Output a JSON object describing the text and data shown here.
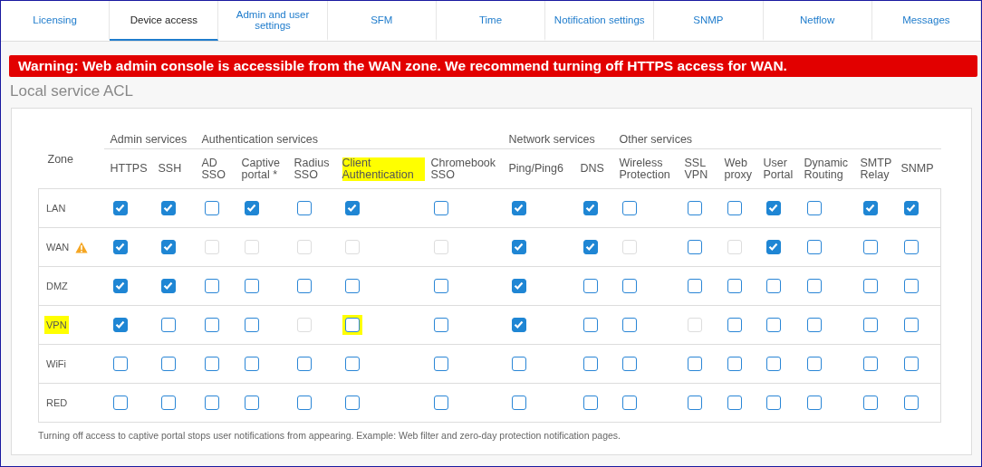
{
  "tabs": [
    {
      "label": "Licensing",
      "selected": false
    },
    {
      "label": "Device access",
      "selected": true
    },
    {
      "label": "Admin and user settings",
      "selected": false
    },
    {
      "label": "SFM",
      "selected": false
    },
    {
      "label": "Time",
      "selected": false
    },
    {
      "label": "Notification settings",
      "selected": false
    },
    {
      "label": "SNMP",
      "selected": false
    },
    {
      "label": "Netflow",
      "selected": false
    },
    {
      "label": "Messages",
      "selected": false
    }
  ],
  "warning_banner": "Warning: Web admin console is accessible from the WAN zone. We recommend turning off HTTPS access for WAN.",
  "section_title": "Local service ACL",
  "table": {
    "zone_heading": "Zone",
    "groups": [
      {
        "label": "Admin services",
        "columns": [
          {
            "label": "HTTPS",
            "highlighted": false
          },
          {
            "label": "SSH",
            "highlighted": false
          }
        ]
      },
      {
        "label": "Authentication services",
        "columns": [
          {
            "label": "AD SSO",
            "highlighted": false
          },
          {
            "label": "Captive portal *",
            "highlighted": false
          },
          {
            "label": "Radius SSO",
            "highlighted": false
          },
          {
            "label": "Client Authentication",
            "highlighted": true
          },
          {
            "label": "Chromebook SSO",
            "highlighted": false
          }
        ]
      },
      {
        "label": "Network services",
        "columns": [
          {
            "label": "Ping/Ping6",
            "highlighted": false
          },
          {
            "label": "DNS",
            "highlighted": false
          }
        ]
      },
      {
        "label": "Other services",
        "columns": [
          {
            "label": "Wireless Protection",
            "highlighted": false
          },
          {
            "label": "SSL VPN",
            "highlighted": false
          },
          {
            "label": "Web proxy",
            "highlighted": false
          },
          {
            "label": "User Portal",
            "highlighted": false
          },
          {
            "label": "Dynamic Routing",
            "highlighted": false
          },
          {
            "label": "SMTP Relay",
            "highlighted": false
          },
          {
            "label": "SNMP",
            "highlighted": false
          }
        ]
      }
    ],
    "rows": [
      {
        "zone": "LAN",
        "warning": false,
        "highlighted": false,
        "cells": [
          {
            "checked": true,
            "disabled": false,
            "highlighted": false
          },
          {
            "checked": true,
            "disabled": false,
            "highlighted": false
          },
          {
            "checked": false,
            "disabled": false,
            "highlighted": false
          },
          {
            "checked": true,
            "disabled": false,
            "highlighted": false
          },
          {
            "checked": false,
            "disabled": false,
            "highlighted": false
          },
          {
            "checked": true,
            "disabled": false,
            "highlighted": false
          },
          {
            "checked": false,
            "disabled": false,
            "highlighted": false
          },
          {
            "checked": true,
            "disabled": false,
            "highlighted": false
          },
          {
            "checked": true,
            "disabled": false,
            "highlighted": false
          },
          {
            "checked": false,
            "disabled": false,
            "highlighted": false
          },
          {
            "checked": false,
            "disabled": false,
            "highlighted": false
          },
          {
            "checked": false,
            "disabled": false,
            "highlighted": false
          },
          {
            "checked": true,
            "disabled": false,
            "highlighted": false
          },
          {
            "checked": false,
            "disabled": false,
            "highlighted": false
          },
          {
            "checked": true,
            "disabled": false,
            "highlighted": false
          },
          {
            "checked": true,
            "disabled": false,
            "highlighted": false
          }
        ]
      },
      {
        "zone": "WAN",
        "warning": true,
        "highlighted": false,
        "cells": [
          {
            "checked": true,
            "disabled": false,
            "highlighted": false
          },
          {
            "checked": true,
            "disabled": false,
            "highlighted": false
          },
          {
            "checked": false,
            "disabled": true,
            "highlighted": false
          },
          {
            "checked": false,
            "disabled": true,
            "highlighted": false
          },
          {
            "checked": false,
            "disabled": true,
            "highlighted": false
          },
          {
            "checked": false,
            "disabled": true,
            "highlighted": false
          },
          {
            "checked": false,
            "disabled": true,
            "highlighted": false
          },
          {
            "checked": true,
            "disabled": false,
            "highlighted": false
          },
          {
            "checked": true,
            "disabled": false,
            "highlighted": false
          },
          {
            "checked": false,
            "disabled": true,
            "highlighted": false
          },
          {
            "checked": false,
            "disabled": false,
            "highlighted": false
          },
          {
            "checked": false,
            "disabled": true,
            "highlighted": false
          },
          {
            "checked": true,
            "disabled": false,
            "highlighted": false
          },
          {
            "checked": false,
            "disabled": false,
            "highlighted": false
          },
          {
            "checked": false,
            "disabled": false,
            "highlighted": false
          },
          {
            "checked": false,
            "disabled": false,
            "highlighted": false
          }
        ]
      },
      {
        "zone": "DMZ",
        "warning": false,
        "highlighted": false,
        "cells": [
          {
            "checked": true,
            "disabled": false,
            "highlighted": false
          },
          {
            "checked": true,
            "disabled": false,
            "highlighted": false
          },
          {
            "checked": false,
            "disabled": false,
            "highlighted": false
          },
          {
            "checked": false,
            "disabled": false,
            "highlighted": false
          },
          {
            "checked": false,
            "disabled": false,
            "highlighted": false
          },
          {
            "checked": false,
            "disabled": false,
            "highlighted": false
          },
          {
            "checked": false,
            "disabled": false,
            "highlighted": false
          },
          {
            "checked": true,
            "disabled": false,
            "highlighted": false
          },
          {
            "checked": false,
            "disabled": false,
            "highlighted": false
          },
          {
            "checked": false,
            "disabled": false,
            "highlighted": false
          },
          {
            "checked": false,
            "disabled": false,
            "highlighted": false
          },
          {
            "checked": false,
            "disabled": false,
            "highlighted": false
          },
          {
            "checked": false,
            "disabled": false,
            "highlighted": false
          },
          {
            "checked": false,
            "disabled": false,
            "highlighted": false
          },
          {
            "checked": false,
            "disabled": false,
            "highlighted": false
          },
          {
            "checked": false,
            "disabled": false,
            "highlighted": false
          }
        ]
      },
      {
        "zone": "VPN",
        "warning": false,
        "highlighted": true,
        "cells": [
          {
            "checked": true,
            "disabled": false,
            "highlighted": false
          },
          {
            "checked": false,
            "disabled": false,
            "highlighted": false
          },
          {
            "checked": false,
            "disabled": false,
            "highlighted": false
          },
          {
            "checked": false,
            "disabled": false,
            "highlighted": false
          },
          {
            "checked": false,
            "disabled": true,
            "highlighted": false
          },
          {
            "checked": false,
            "disabled": false,
            "highlighted": true
          },
          {
            "checked": false,
            "disabled": false,
            "highlighted": false
          },
          {
            "checked": true,
            "disabled": false,
            "highlighted": false
          },
          {
            "checked": false,
            "disabled": false,
            "highlighted": false
          },
          {
            "checked": false,
            "disabled": false,
            "highlighted": false
          },
          {
            "checked": false,
            "disabled": true,
            "highlighted": false
          },
          {
            "checked": false,
            "disabled": false,
            "highlighted": false
          },
          {
            "checked": false,
            "disabled": false,
            "highlighted": false
          },
          {
            "checked": false,
            "disabled": false,
            "highlighted": false
          },
          {
            "checked": false,
            "disabled": false,
            "highlighted": false
          },
          {
            "checked": false,
            "disabled": false,
            "highlighted": false
          }
        ]
      },
      {
        "zone": "WiFi",
        "warning": false,
        "highlighted": false,
        "cells": [
          {
            "checked": false,
            "disabled": false,
            "highlighted": false
          },
          {
            "checked": false,
            "disabled": false,
            "highlighted": false
          },
          {
            "checked": false,
            "disabled": false,
            "highlighted": false
          },
          {
            "checked": false,
            "disabled": false,
            "highlighted": false
          },
          {
            "checked": false,
            "disabled": false,
            "highlighted": false
          },
          {
            "checked": false,
            "disabled": false,
            "highlighted": false
          },
          {
            "checked": false,
            "disabled": false,
            "highlighted": false
          },
          {
            "checked": false,
            "disabled": false,
            "highlighted": false
          },
          {
            "checked": false,
            "disabled": false,
            "highlighted": false
          },
          {
            "checked": false,
            "disabled": false,
            "highlighted": false
          },
          {
            "checked": false,
            "disabled": false,
            "highlighted": false
          },
          {
            "checked": false,
            "disabled": false,
            "highlighted": false
          },
          {
            "checked": false,
            "disabled": false,
            "highlighted": false
          },
          {
            "checked": false,
            "disabled": false,
            "highlighted": false
          },
          {
            "checked": false,
            "disabled": false,
            "highlighted": false
          },
          {
            "checked": false,
            "disabled": false,
            "highlighted": false
          }
        ]
      },
      {
        "zone": "RED",
        "warning": false,
        "highlighted": false,
        "cells": [
          {
            "checked": false,
            "disabled": false,
            "highlighted": false
          },
          {
            "checked": false,
            "disabled": false,
            "highlighted": false
          },
          {
            "checked": false,
            "disabled": false,
            "highlighted": false
          },
          {
            "checked": false,
            "disabled": false,
            "highlighted": false
          },
          {
            "checked": false,
            "disabled": false,
            "highlighted": false
          },
          {
            "checked": false,
            "disabled": false,
            "highlighted": false
          },
          {
            "checked": false,
            "disabled": false,
            "highlighted": false
          },
          {
            "checked": false,
            "disabled": false,
            "highlighted": false
          },
          {
            "checked": false,
            "disabled": false,
            "highlighted": false
          },
          {
            "checked": false,
            "disabled": false,
            "highlighted": false
          },
          {
            "checked": false,
            "disabled": false,
            "highlighted": false
          },
          {
            "checked": false,
            "disabled": false,
            "highlighted": false
          },
          {
            "checked": false,
            "disabled": false,
            "highlighted": false
          },
          {
            "checked": false,
            "disabled": false,
            "highlighted": false
          },
          {
            "checked": false,
            "disabled": false,
            "highlighted": false
          },
          {
            "checked": false,
            "disabled": false,
            "highlighted": false
          }
        ]
      }
    ]
  },
  "footnote": "Turning off access to captive portal stops user notifications from appearing. Example: Web filter and zero-day protection notification pages."
}
